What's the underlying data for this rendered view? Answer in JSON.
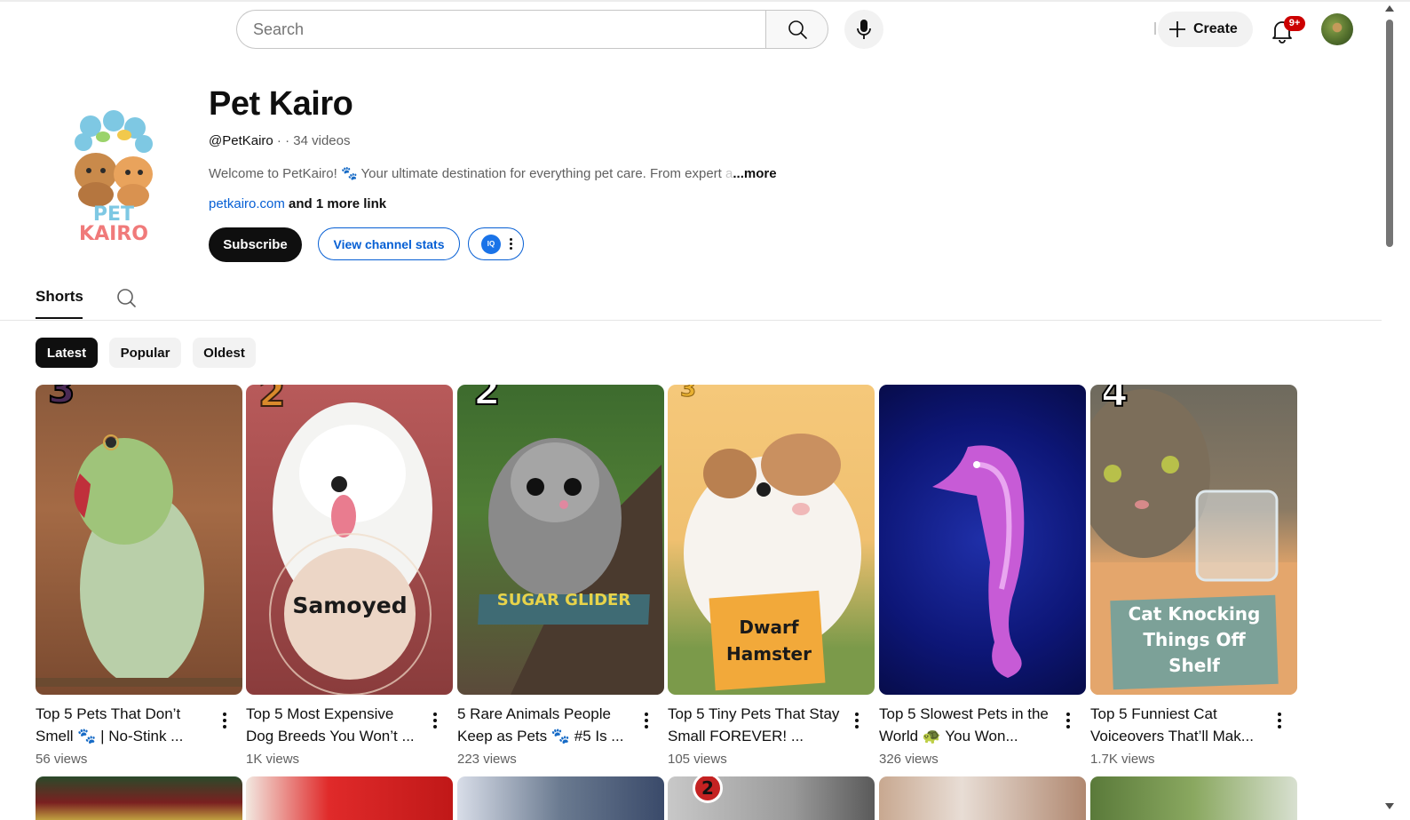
{
  "header": {
    "search_placeholder": "Search",
    "create_label": "Create",
    "notification_badge": "9+"
  },
  "channel": {
    "name": "Pet Kairo",
    "logo_text_top": "PET",
    "logo_text_bottom": "KAIRO",
    "handle": "@PetKairo",
    "meta_separator": " · ",
    "video_count": "· 34 videos",
    "description": "Welcome to PetKairo! 🐾 Your ultimate destination for everything pet care. From expert",
    "description_fade": " a",
    "description_more": "...more",
    "link": "petkairo.com",
    "link_more": " and 1 more link",
    "subscribe_label": "Subscribe",
    "stats_label": "View channel stats",
    "ext_icon_label": "IQ"
  },
  "tabs": {
    "shorts_label": "Shorts"
  },
  "chips": [
    {
      "label": "Latest",
      "active": true
    },
    {
      "label": "Popular",
      "active": false
    },
    {
      "label": "Oldest",
      "active": false
    }
  ],
  "shorts": [
    {
      "title": "Top 5 Pets That Don’t Smell 🐾 | No-Stink ...",
      "views": "56 views",
      "number": "3",
      "overlay": ""
    },
    {
      "title": "Top 5 Most Expensive Dog Breeds You Won’t ...",
      "views": "1K views",
      "number": "2",
      "overlay": "Samoyed"
    },
    {
      "title": "5 Rare Animals People Keep as Pets 🐾 #5 Is ...",
      "views": "223 views",
      "number": "2",
      "overlay": "SUGAR GLIDER"
    },
    {
      "title": "Top 5 Tiny Pets That Stay Small FOREVER! ...",
      "views": "105 views",
      "number": "3",
      "overlay_line1": "Dwarf",
      "overlay_line2": "Hamster"
    },
    {
      "title": "Top 5 Slowest Pets in the World 🐢 You Won...",
      "views": "326 views",
      "number": "",
      "overlay": ""
    },
    {
      "title": "Top 5 Funniest Cat Voiceovers That’ll Mak...",
      "views": "1.7K views",
      "number": "4",
      "overlay_line1": "Cat Knocking",
      "overlay_line2": "Things Off",
      "overlay_line3": "Shelf"
    }
  ],
  "row2_badge": "2"
}
